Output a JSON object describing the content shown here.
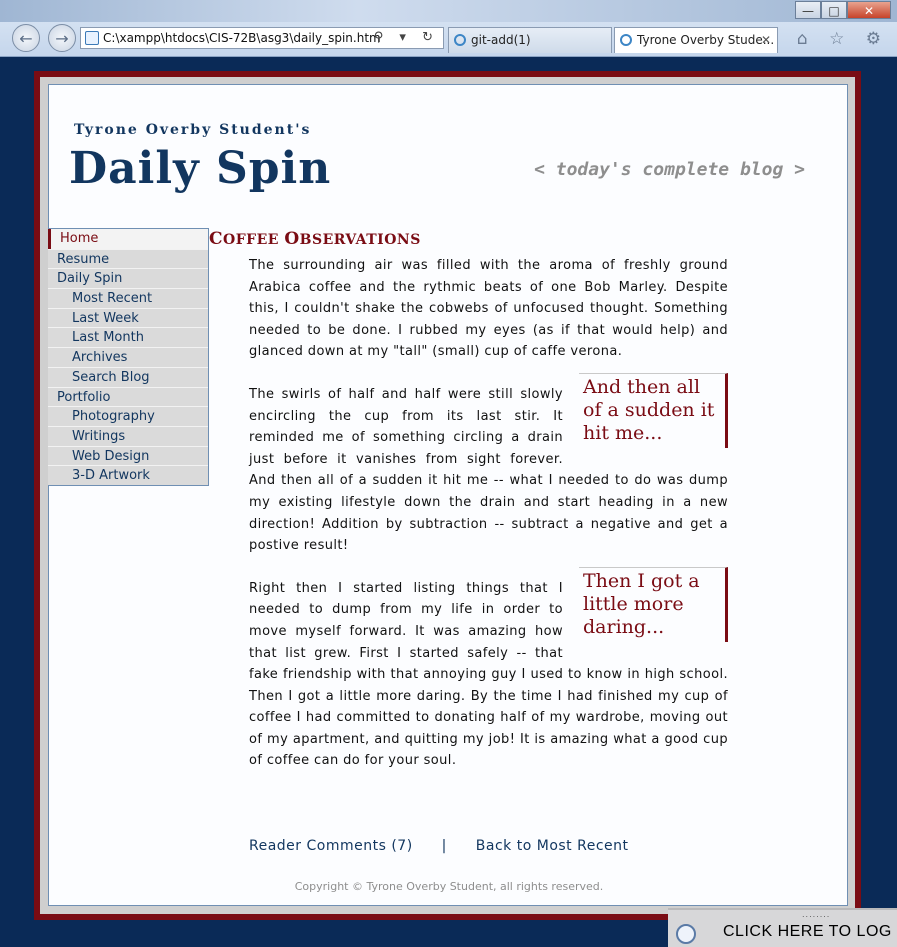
{
  "browser": {
    "url": "C:\\xampp\\htdocs\\CIS-72B\\asg3\\daily_spin.htm",
    "tabs": [
      {
        "label": "git-add(1)"
      },
      {
        "label": "Tyrone Overby Stude..."
      }
    ],
    "window_buttons": {
      "minimize": "—",
      "maximize": "□",
      "close": "✕"
    },
    "nav": {
      "back": "←",
      "forward": "→"
    },
    "addr_tools": "⚲ ▾ ↻",
    "right_icons": "⌂ ☆ ⚙"
  },
  "header": {
    "owner": "Tyrone Overby Student's",
    "title": "Daily Spin",
    "tagline": "< today's complete blog >"
  },
  "nav": {
    "items": [
      {
        "label": "Home",
        "level": 0,
        "active": true
      },
      {
        "label": "Resume",
        "level": 0
      },
      {
        "label": "Daily Spin",
        "level": 0
      },
      {
        "label": "Most Recent",
        "level": 1
      },
      {
        "label": "Last Week",
        "level": 1
      },
      {
        "label": "Last Month",
        "level": 1
      },
      {
        "label": "Archives",
        "level": 1
      },
      {
        "label": "Search Blog",
        "level": 1
      },
      {
        "label": "Portfolio",
        "level": 0
      },
      {
        "label": "Photography",
        "level": 1
      },
      {
        "label": "Writings",
        "level": 1
      },
      {
        "label": "Web Design",
        "level": 1
      },
      {
        "label": "3-D Artwork",
        "level": 1
      }
    ]
  },
  "article": {
    "heading_first": "C",
    "heading_rest": "OFFEE ",
    "heading_first2": "O",
    "heading_rest2": "BSERVATIONS",
    "p1": "The surrounding air was filled with the aroma of freshly ground Arabica coffee and the rythmic beats of one Bob Marley. Despite this, I couldn't shake the cobwebs of unfocused thought. Something needed to be done. I rubbed my eyes (as if that would help) and glanced down at my \"tall\" (small) cup of caffe verona.",
    "pull1": "And then all of a sudden it hit me...",
    "p2": "The swirls of half and half were still slowly encircling the cup from its last stir. It reminded me of something circling a drain just before it vanishes from sight forever. And then all of a sudden it hit me -- what I needed to do was dump my existing lifestyle down the drain and start heading in a new direction! Addition by subtraction -- subtract a negative and get a postive result!",
    "pull2": "Then I got a little more daring...",
    "p3": "Right then I started listing things that I needed to dump from my life in order to move myself forward. It was amazing how that list grew. First I started safely -- that fake friendship with that annoying guy I used to know in high school. Then I got a little more daring. By the time I had finished my cup of coffee I had committed to donating half of my wardrobe, moving out of my apartment, and quitting my job! It is amazing what a good cup of coffee can do for your soul."
  },
  "footer_links": {
    "comments": "Reader Comments (7)",
    "separator": "|",
    "back": "Back to Most Recent"
  },
  "copyright": "Copyright © Tyrone Overby Student, all rights reserved.",
  "overlay": {
    "login_text": "CLICK HERE TO LOG",
    "grip": "........"
  }
}
